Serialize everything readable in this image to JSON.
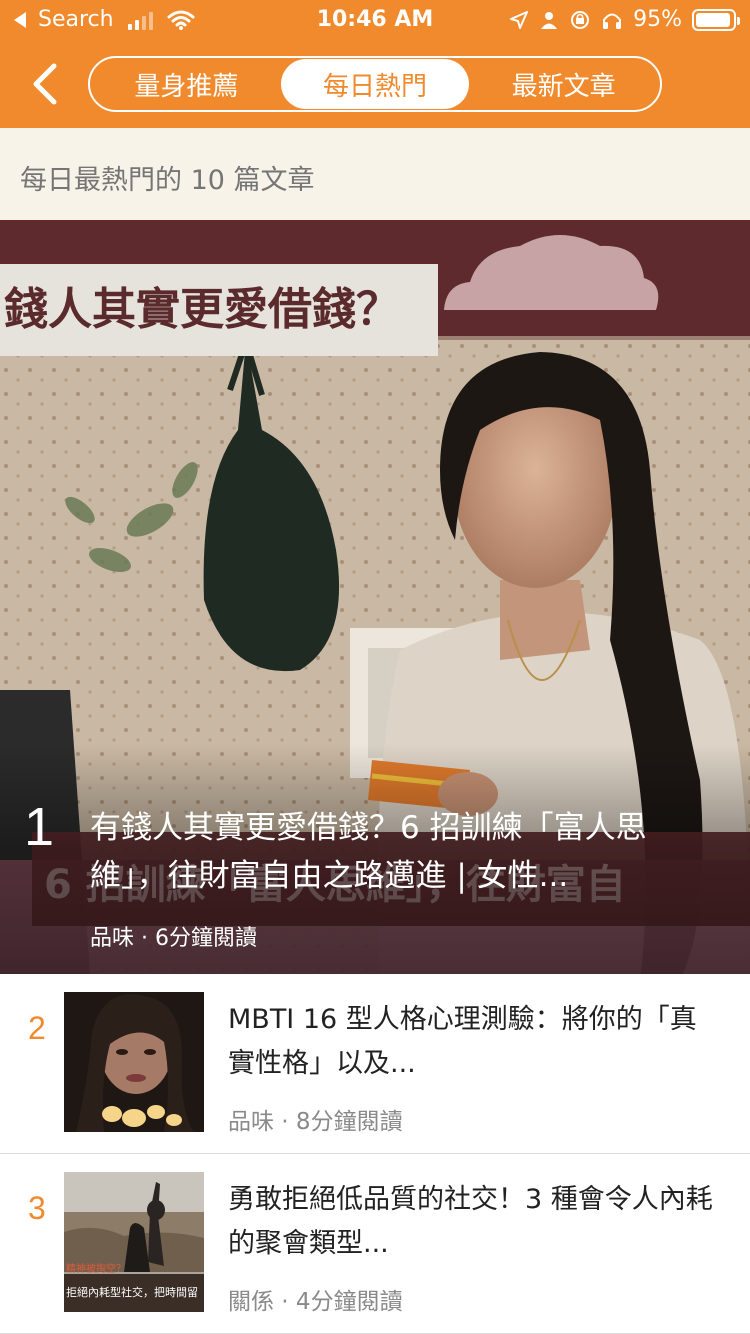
{
  "status_bar": {
    "back_label": "Search",
    "time": "10:46 AM",
    "battery": "95%",
    "battery_level": 0.95,
    "icons": [
      "signal-icon",
      "wifi-icon",
      "location-arrow-icon",
      "person-icon",
      "rotation-lock-icon",
      "headphones-icon",
      "battery-icon"
    ]
  },
  "nav": {
    "back_icon": "chevron-left-icon",
    "tabs": [
      {
        "label": "量身推薦",
        "active": false
      },
      {
        "label": "每日熱門",
        "active": true
      },
      {
        "label": "最新文章",
        "active": false
      }
    ]
  },
  "subtitle": "每日最熱門的 10 篇文章",
  "colors": {
    "accent": "#f08a2c",
    "subtitle_bg": "#f8f3e9",
    "banner_maroon": "#5e2a2e"
  },
  "hero": {
    "rank": "1",
    "banner_text": "錢人其實更愛借錢？",
    "title": "有錢人其實更愛借錢？6 招訓練「富人思維」，往財富自由之路邁進 | 女性...",
    "meta": "品味 · 6分鐘閱讀"
  },
  "articles": [
    {
      "rank": "2",
      "title": "MBTI 16 型人格心理測驗：將你的「真實性格」以及...",
      "meta": "品味 · 8分鐘閱讀"
    },
    {
      "rank": "3",
      "title": "勇敢拒絕低品質的社交！3 種會令人內耗的聚會類型...",
      "meta": "關係 · 4分鐘閱讀",
      "thumb_caption_1": "精神被掏空？",
      "thumb_caption_2": "拒絕內耗型社交，把時間留"
    }
  ]
}
